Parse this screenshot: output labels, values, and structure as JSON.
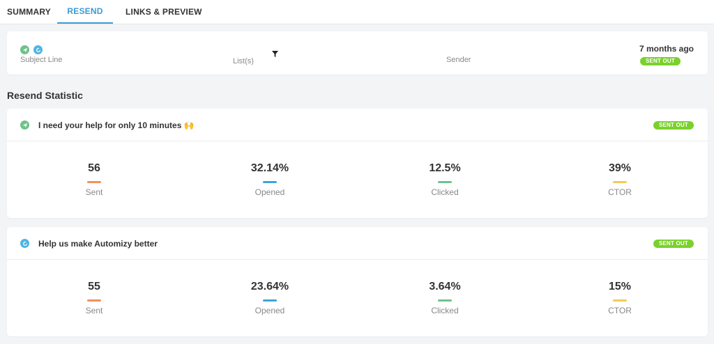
{
  "tabs": [
    {
      "label": "SUMMARY"
    },
    {
      "label": "RESEND"
    },
    {
      "label": "LINKS & PREVIEW"
    }
  ],
  "info": {
    "subject_label": "Subject Line",
    "lists_label": "List(s)",
    "sender_label": "Sender",
    "time_ago": "7 months ago",
    "status": "SENT OUT"
  },
  "section_title": "Resend Statistic",
  "stats": [
    {
      "title": "I need your help for only 10 minutes 🙌",
      "icon": "send-icon",
      "status": "SENT OUT",
      "metrics": [
        {
          "value": "56",
          "label": "Sent"
        },
        {
          "value": "32.14%",
          "label": "Opened"
        },
        {
          "value": "12.5%",
          "label": "Clicked"
        },
        {
          "value": "39%",
          "label": "CTOR"
        }
      ]
    },
    {
      "title": "Help us make Automizy better",
      "icon": "resend-icon",
      "status": "SENT OUT",
      "metrics": [
        {
          "value": "55",
          "label": "Sent"
        },
        {
          "value": "23.64%",
          "label": "Opened"
        },
        {
          "value": "3.64%",
          "label": "Clicked"
        },
        {
          "value": "15%",
          "label": "CTOR"
        }
      ]
    }
  ],
  "colors": {
    "accent": "#3d9ad1",
    "sent": "#f0905e",
    "opened": "#3da5d6",
    "clicked": "#6ec28e",
    "ctor": "#f4c95a",
    "badge": "#7ad12c"
  }
}
